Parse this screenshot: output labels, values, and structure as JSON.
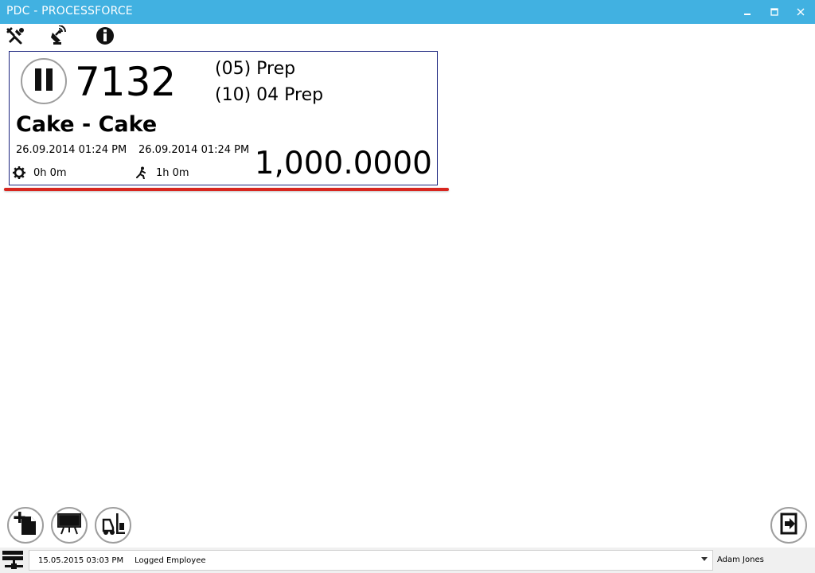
{
  "window": {
    "title": "PDC - PROCESSFORCE",
    "controls": [
      "minimize-icon",
      "maximize-icon",
      "close-icon"
    ]
  },
  "toolbar": {
    "icons": [
      "tools-icon",
      "satellite-icon",
      "info-icon"
    ]
  },
  "order_card": {
    "status_icon": "pause-icon",
    "order_number": "7132",
    "operations": [
      "(05) Prep",
      "(10) 04 Prep"
    ],
    "item_name": "Cake - Cake",
    "start_date": "26.09.2014 01:24 PM",
    "end_date": "26.09.2014 01:24 PM",
    "setup_time": "0h 0m",
    "run_time": "1h 0m",
    "quantity": "1,000.0000",
    "border_color": "#1a237e",
    "accent_color": "#d8261f"
  },
  "bottom_actions": {
    "left": [
      "new-document-icon",
      "board-icon",
      "forklift-icon"
    ],
    "right": [
      "logout-icon"
    ]
  },
  "statusbar": {
    "icon": "network-icon",
    "date": "15.05.2015 03:03 PM",
    "employee_label": "Logged Employee",
    "user": "Adam Jones"
  },
  "colors": {
    "titlebar": "#41b1e1",
    "card_border": "#1a237e",
    "underline": "#d8261f"
  }
}
